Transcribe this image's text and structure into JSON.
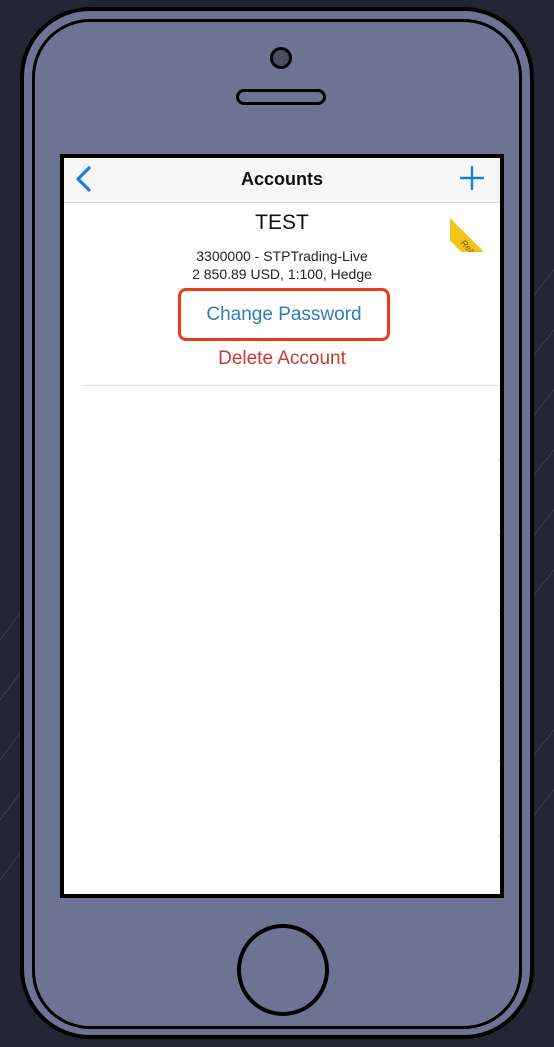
{
  "navbar": {
    "title": "Accounts",
    "back_icon": "chevron-left-icon",
    "add_icon": "plus-icon"
  },
  "ribbon": {
    "label": "Real",
    "color": "#f3c418"
  },
  "account": {
    "name": "TEST",
    "line1": "3300000 - STPTrading-Live",
    "line2": "2 850.89 USD, 1:100, Hedge"
  },
  "actions": {
    "change_password": "Change Password",
    "delete_account": "Delete Account"
  },
  "colors": {
    "link_blue": "#2f7cbd",
    "destructive_red": "#c23b34",
    "highlight_border": "#ee3a1b",
    "device_body": "#6c7393",
    "background": "#222632"
  }
}
